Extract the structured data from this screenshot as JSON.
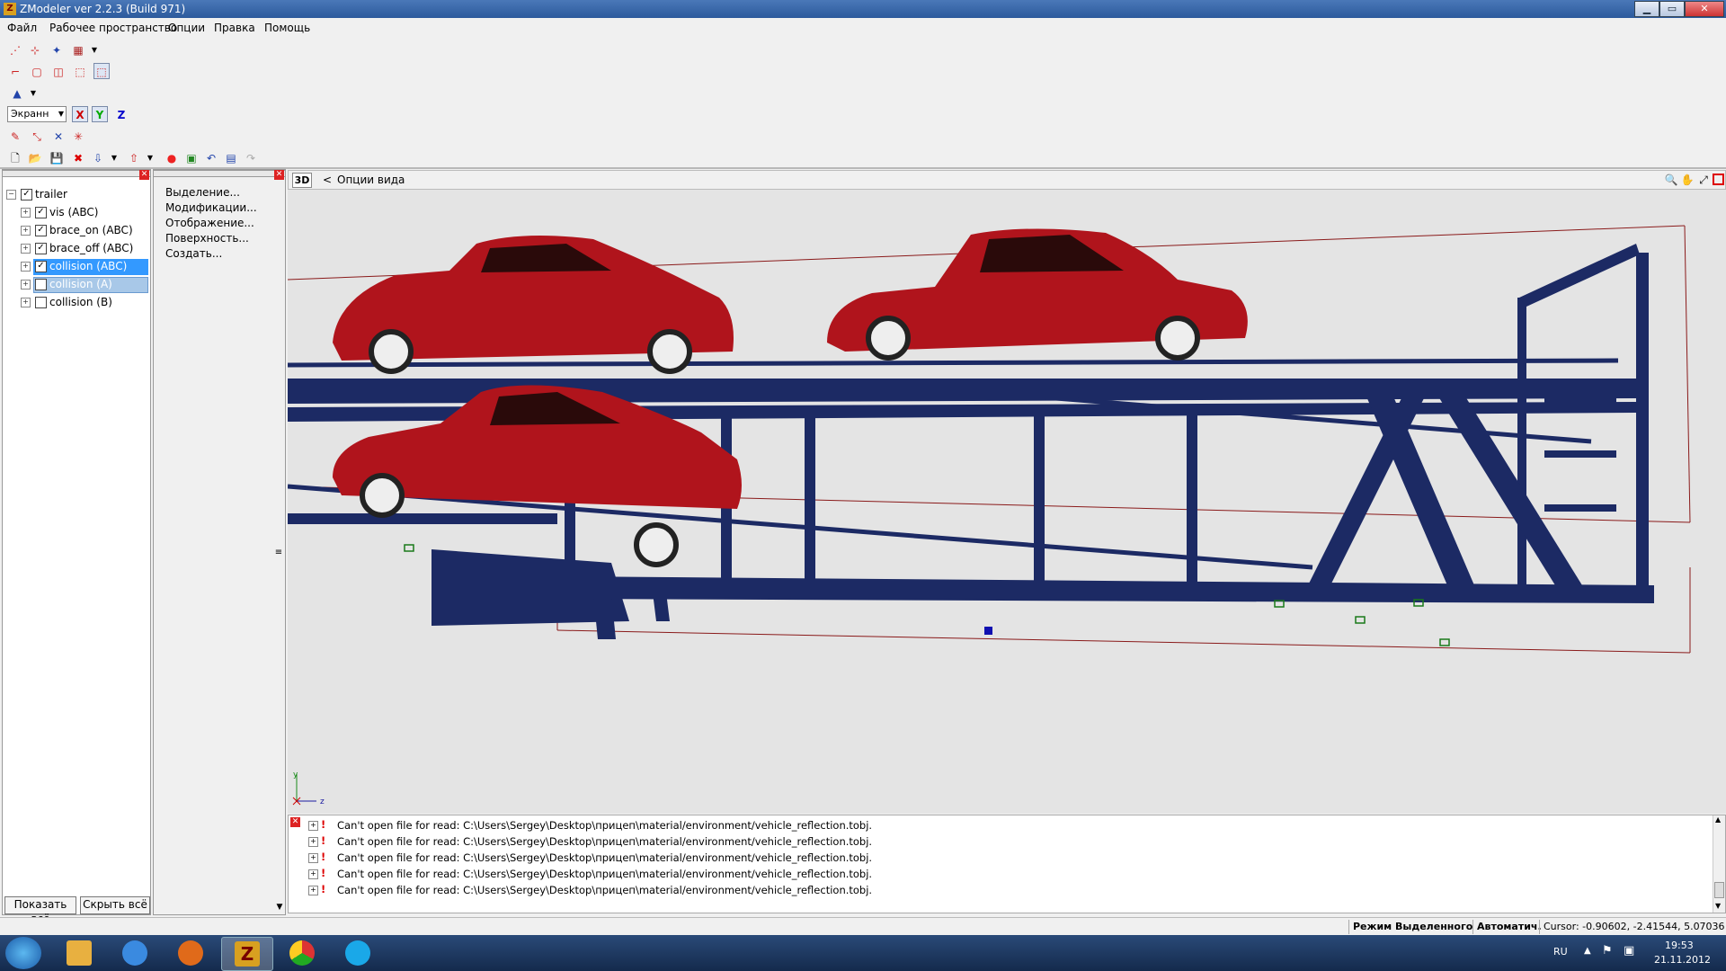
{
  "window": {
    "title": "ZModeler ver 2.2.3 (Build 971)",
    "minimize": "▁",
    "maximize": "▭",
    "close": "✕"
  },
  "menu": [
    "Файл",
    "Рабочее пространство",
    "Опции",
    "Правка",
    "Помощь"
  ],
  "toolbar": {
    "row1": [
      "select-icon",
      "select-tool-icon",
      "move-icon",
      "multi-icon",
      "dropdown-icon"
    ],
    "row2": [
      "vertex-icon",
      "edge-icon",
      "poly-icon",
      "object-icon",
      "object-selected-icon"
    ],
    "row3": [
      "axis-icon",
      "dropdown-icon"
    ],
    "coord_mode": "Экранн",
    "axes": [
      "X",
      "Y",
      "Z"
    ],
    "row5": [
      "paint-icon",
      "pivot-icon",
      "snap-icon",
      "scale-icon"
    ],
    "row6": [
      "new-icon",
      "open-icon",
      "save-icon",
      "delete-icon",
      "import-icon",
      "dropdown-icon",
      "export-icon",
      "dropdown-icon",
      "record-icon",
      "render-icon",
      "undo-icon",
      "doc-icon",
      "redo-icon"
    ]
  },
  "tree": {
    "root": "trailer",
    "items": [
      {
        "label": "vis (ABC)",
        "checked": true,
        "selected": false
      },
      {
        "label": "brace_on (ABC)",
        "checked": true,
        "selected": false
      },
      {
        "label": "brace_off (ABC)",
        "checked": true,
        "selected": false
      },
      {
        "label": "collision (ABC)",
        "checked": true,
        "selected": true
      },
      {
        "label": "collision (A)",
        "checked": false,
        "selected": true
      },
      {
        "label": "collision (B)",
        "checked": false,
        "selected": false
      }
    ],
    "show_all": "Показать всё",
    "hide_all": "Скрыть всё"
  },
  "options": [
    "Выделение...",
    "Модификации...",
    "Отображение...",
    "Поверхность...",
    "Создать..."
  ],
  "viewport": {
    "mode": "3D",
    "arrow": "<",
    "title": "Опции вида",
    "axis_y": "y",
    "axis_z": "z"
  },
  "log": {
    "lines": [
      "Can't open file for read: C:\\Users\\Sergey\\Desktop\\прицеп\\material/environment/vehicle_reflection.tobj.",
      "Can't open file for read: C:\\Users\\Sergey\\Desktop\\прицеп\\material/environment/vehicle_reflection.tobj.",
      "Can't open file for read: C:\\Users\\Sergey\\Desktop\\прицеп\\material/environment/vehicle_reflection.tobj.",
      "Can't open file for read: C:\\Users\\Sergey\\Desktop\\прицеп\\material/environment/vehicle_reflection.tobj.",
      "Can't open file for read: C:\\Users\\Sergey\\Desktop\\прицеп\\material/environment/vehicle_reflection.tobj."
    ]
  },
  "status": {
    "mode": "Режим Выделенного",
    "auto": "Автоматич.",
    "cursor": "Cursor: -0.90602, -2.41544, 5.07036"
  },
  "taskbar": {
    "lang": "RU",
    "time": "19:53",
    "date": "21.11.2012"
  },
  "colors": {
    "car": "#b0141c",
    "frame": "#1c2a64",
    "selection": "#3399ff",
    "title": "#2c5a9c"
  }
}
